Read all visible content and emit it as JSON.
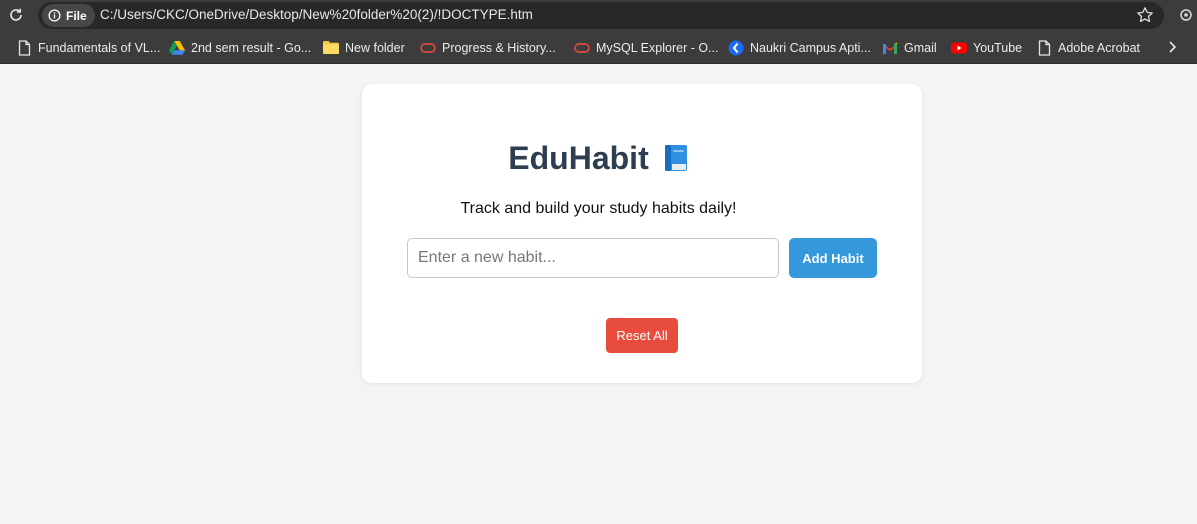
{
  "browser": {
    "file_chip": "File",
    "url": "C:/Users/CKC/OneDrive/Desktop/New%20folder%20(2)/!DOCTYPE.htm",
    "bookmarks": [
      {
        "label": "Fundamentals of VL...",
        "icon": "page-icon"
      },
      {
        "label": "2nd sem result - Go...",
        "icon": "google-drive-icon"
      },
      {
        "label": "New folder",
        "icon": "folder-icon"
      },
      {
        "label": "Progress & History...",
        "icon": "oracle-icon"
      },
      {
        "label": "MySQL Explorer - O...",
        "icon": "oracle-icon"
      },
      {
        "label": "Naukri Campus Apti...",
        "icon": "naukri-icon"
      },
      {
        "label": "Gmail",
        "icon": "gmail-icon"
      },
      {
        "label": "YouTube",
        "icon": "youtube-icon"
      },
      {
        "label": "Adobe Acrobat",
        "icon": "page-icon"
      }
    ]
  },
  "app": {
    "title": "EduHabit",
    "title_icon": "blue-book-emoji",
    "subtitle": "Track and build your study habits daily!",
    "input_placeholder": "Enter a new habit...",
    "input_value": "",
    "add_label": "Add Habit",
    "reset_label": "Reset All"
  },
  "colors": {
    "title": "#2c3e50",
    "add_button": "#3498db",
    "reset_button": "#e74c3c",
    "page_background": "#f4f4f4"
  }
}
